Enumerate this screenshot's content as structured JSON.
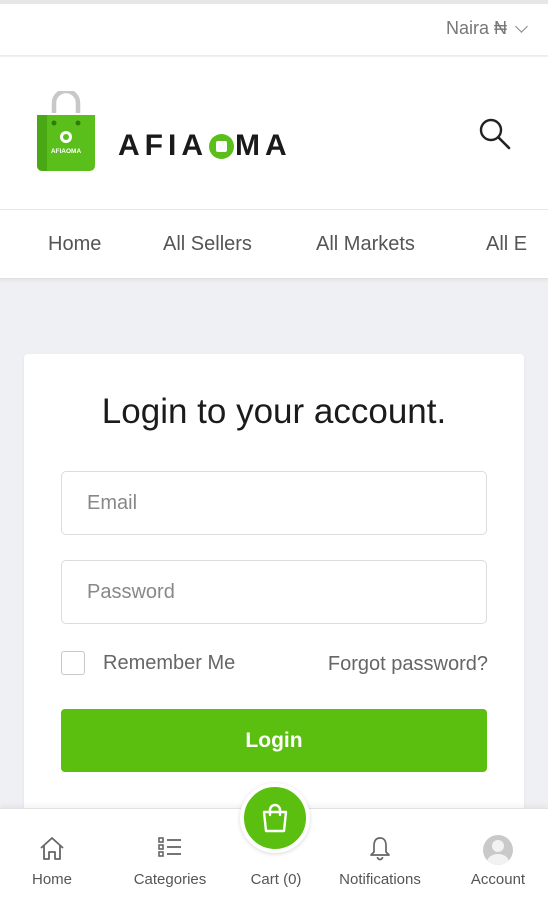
{
  "topbar": {
    "currency": "Naira ₦"
  },
  "header": {
    "brand_pre": "AFIA",
    "brand_post": "MA",
    "bag_text": "AFIAOMA",
    "brand_color": "#5bbf1b"
  },
  "nav": {
    "items": [
      "Home",
      "All Sellers",
      "All Markets",
      "All E"
    ]
  },
  "login": {
    "title": "Login to your account.",
    "email_placeholder": "Email",
    "password_placeholder": "Password",
    "remember_label": "Remember Me",
    "forgot_label": "Forgot password?",
    "button_label": "Login",
    "button_color": "#5bbf0f"
  },
  "bottom_nav": {
    "home": "Home",
    "categories": "Categories",
    "cart": "Cart (0)",
    "notifications": "Notifications",
    "account": "Account"
  }
}
